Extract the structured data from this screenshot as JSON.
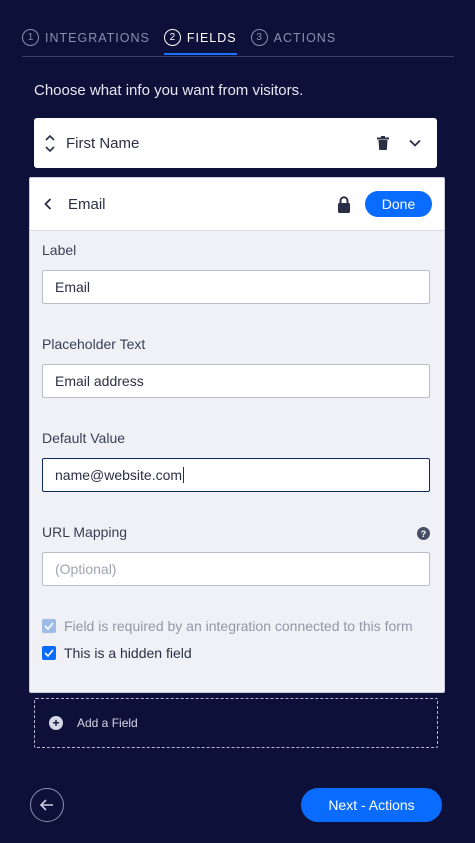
{
  "steps": [
    {
      "num": "1",
      "label": "INTEGRATIONS"
    },
    {
      "num": "2",
      "label": "FIELDS"
    },
    {
      "num": "3",
      "label": "ACTIONS"
    }
  ],
  "intro": "Choose what info you want from visitors.",
  "collapsed_field": {
    "name": "First Name"
  },
  "panel": {
    "title": "Email",
    "done_label": "Done",
    "label_heading": "Label",
    "label_value": "Email",
    "placeholder_heading": "Placeholder Text",
    "placeholder_value": "Email address",
    "default_heading": "Default Value",
    "default_value": "name@website.com",
    "url_heading": "URL Mapping",
    "url_placeholder": "(Optional)",
    "required_text": "Field is required by an integration connected to this form",
    "hidden_text": "This is a hidden field"
  },
  "add_field": "Add a Field",
  "next_label": "Next - Actions",
  "colors": {
    "accent": "#0a6cff",
    "background": "#0d1139"
  },
  "icons": [
    "trash-icon",
    "chevron-down-icon",
    "lock-icon",
    "chevron-left-icon",
    "help-icon",
    "plus-icon",
    "arrow-left-icon"
  ]
}
